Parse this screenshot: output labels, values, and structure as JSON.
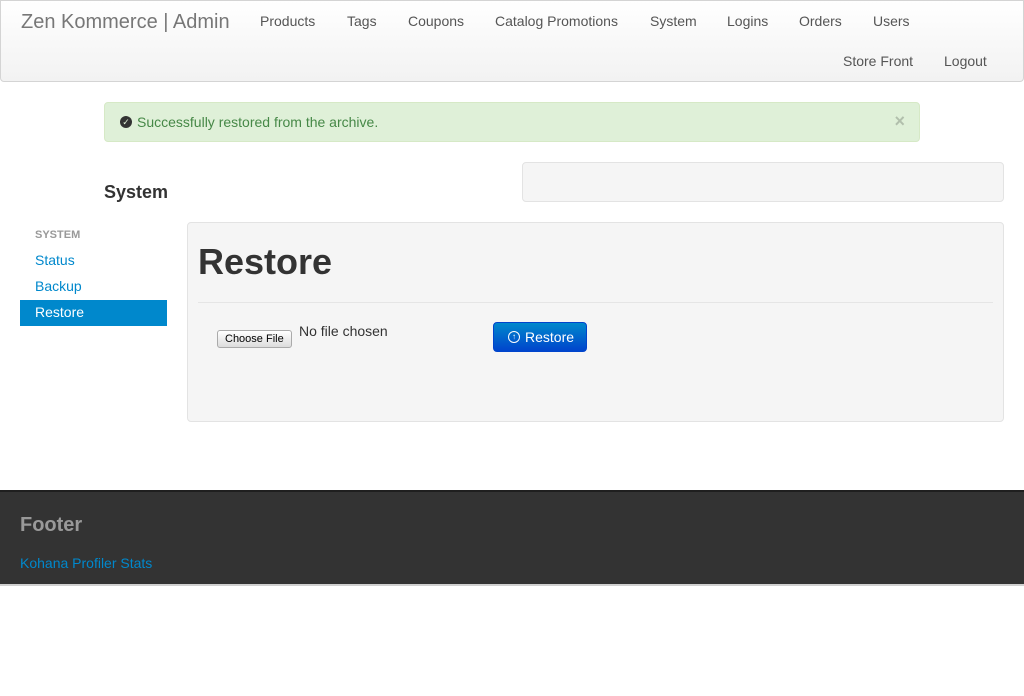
{
  "brand": "Zen Kommerce | Admin",
  "nav": {
    "items": [
      "Products",
      "Tags",
      "Coupons",
      "Catalog Promotions",
      "System",
      "Logins",
      "Orders",
      "Users"
    ],
    "store_front": "Store Front",
    "logout": "Logout"
  },
  "alert": {
    "message": "Successfully restored from the archive.",
    "close": "×",
    "icon": "check-circle-icon"
  },
  "section_title": "System",
  "sidebar": {
    "header": "SYSTEM",
    "items": [
      {
        "label": "Status",
        "active": false
      },
      {
        "label": "Backup",
        "active": false
      },
      {
        "label": "Restore",
        "active": true
      }
    ]
  },
  "main": {
    "heading": "Restore",
    "file_button": "Choose File",
    "file_status": "No file chosen",
    "restore_button": "Restore",
    "restore_icon": "upload-circle-icon"
  },
  "footer": {
    "title": "Footer",
    "link": "Kohana Profiler Stats"
  },
  "colors": {
    "accent": "#0088cc",
    "alert_bg": "#dff0d8",
    "alert_text": "#468847",
    "footer_bg": "#333333"
  }
}
